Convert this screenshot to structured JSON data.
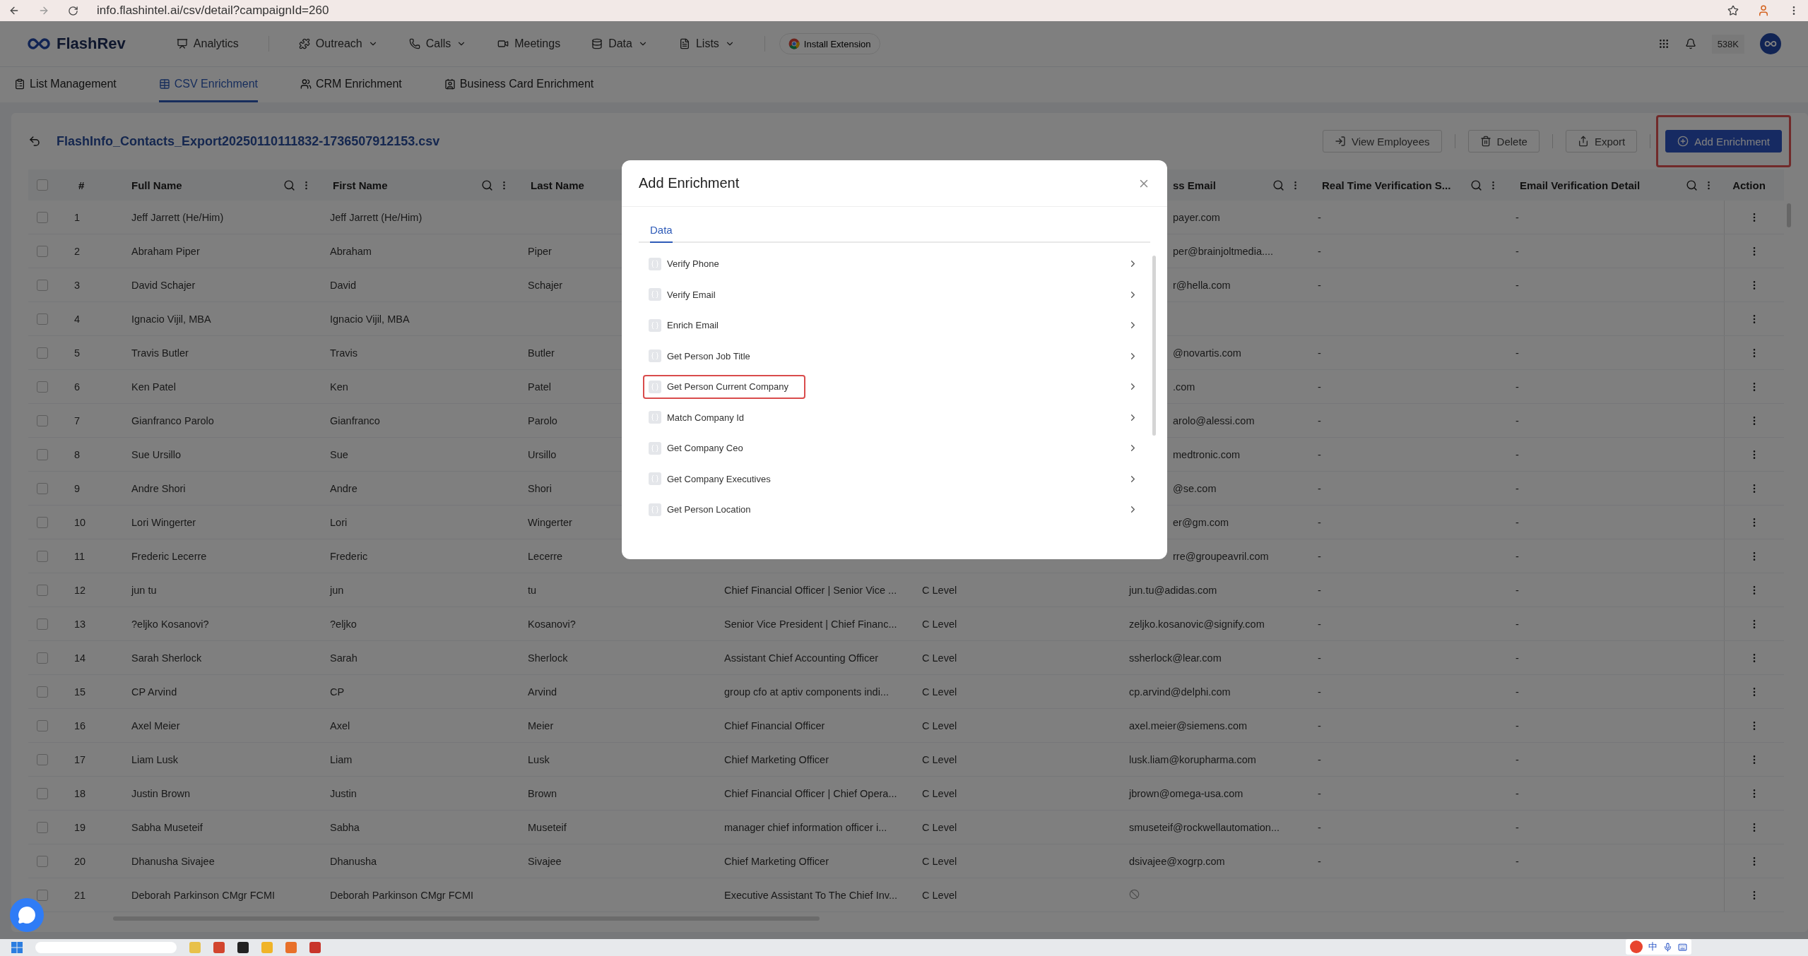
{
  "browser": {
    "url": "info.flashintel.ai/csv/detail?campaignId=260"
  },
  "header": {
    "logo": "FlashRev",
    "nav": [
      {
        "label": "Analytics",
        "kind": "chart",
        "dropdown": false
      },
      {
        "label": "Outreach",
        "kind": "puzzle",
        "dropdown": true
      },
      {
        "label": "Calls",
        "kind": "phone",
        "dropdown": true
      },
      {
        "label": "Meetings",
        "kind": "video",
        "dropdown": false
      },
      {
        "label": "Data",
        "kind": "database",
        "dropdown": true
      },
      {
        "label": "Lists",
        "kind": "list",
        "dropdown": true
      }
    ],
    "extension_button": "Install Extension",
    "credits": "538K"
  },
  "subtabs": [
    {
      "label": "List Management",
      "kind": "clipboard",
      "selected": false
    },
    {
      "label": "CSV Enrichment",
      "kind": "table",
      "selected": true
    },
    {
      "label": "CRM Enrichment",
      "kind": "users",
      "selected": false
    },
    {
      "label": "Business Card Enrichment",
      "kind": "card",
      "selected": false
    }
  ],
  "file_title": "FlashInfo_Contacts_Export20250110111832-1736507912153.csv",
  "actions": [
    {
      "label": "View Employees",
      "kind": "view",
      "primary": false,
      "highlighted": false
    },
    {
      "label": "Delete",
      "kind": "delete",
      "primary": false,
      "highlighted": false
    },
    {
      "label": "Export",
      "kind": "export",
      "primary": false,
      "highlighted": false
    },
    {
      "label": "Add Enrichment",
      "kind": "add",
      "primary": true,
      "highlighted": true
    }
  ],
  "table": {
    "header_checked": false,
    "columns": [
      {
        "label": "#",
        "tools": false,
        "kind": "text"
      },
      {
        "label": "Full Name",
        "tools": true,
        "kind": "text"
      },
      {
        "label": "First Name",
        "tools": true,
        "kind": "text"
      },
      {
        "label": "Last Name",
        "kind": "text"
      },
      {
        "kind": "covered"
      },
      {
        "kind": "covered"
      },
      {
        "label": "ss Email",
        "tools": true,
        "kind": "clipped"
      },
      {
        "label": "Real Time Verification S...",
        "tools": true,
        "kind": "text"
      },
      {
        "label": "Email Verification Detail",
        "tools": true,
        "kind": "text"
      },
      {
        "label": "Action",
        "tools": false,
        "kind": "center"
      }
    ],
    "rows": [
      {
        "checked": false,
        "clipped": true,
        "num": "1",
        "full_name": "Jeff Jarrett (He/Him)",
        "first_name": "Jeff Jarrett (He/Him)",
        "email": "payer.com",
        "rtv": "-",
        "evd": "-"
      },
      {
        "checked": false,
        "clipped": true,
        "num": "2",
        "full_name": "Abraham Piper",
        "first_name": "Abraham",
        "last_name": "Piper",
        "email": "per@brainjoltmedia....",
        "rtv": "-",
        "evd": "-"
      },
      {
        "checked": false,
        "clipped": true,
        "num": "3",
        "full_name": "David Schajer",
        "first_name": "David",
        "last_name": "Schajer",
        "email": "r@hella.com",
        "rtv": "-",
        "evd": "-"
      },
      {
        "checked": false,
        "num": "4",
        "full_name": "Ignacio Vijil, MBA",
        "first_name": "Ignacio Vijil, MBA"
      },
      {
        "checked": false,
        "clipped": true,
        "num": "5",
        "full_name": "Travis Butler",
        "first_name": "Travis",
        "last_name": "Butler",
        "email": "@novartis.com",
        "rtv": "-",
        "evd": "-"
      },
      {
        "checked": false,
        "clipped": true,
        "num": "6",
        "full_name": "Ken Patel",
        "first_name": "Ken",
        "last_name": "Patel",
        "email": ".com",
        "rtv": "-",
        "evd": "-"
      },
      {
        "checked": false,
        "clipped": true,
        "num": "7",
        "full_name": "Gianfranco Parolo",
        "first_name": "Gianfranco",
        "last_name": "Parolo",
        "email": "arolo@alessi.com",
        "rtv": "-",
        "evd": "-"
      },
      {
        "checked": false,
        "clipped": true,
        "num": "8",
        "full_name": "Sue Ursillo",
        "first_name": "Sue",
        "last_name": "Ursillo",
        "email": "medtronic.com",
        "rtv": "-",
        "evd": "-"
      },
      {
        "checked": false,
        "clipped": true,
        "num": "9",
        "full_name": "Andre Shori",
        "first_name": "Andre",
        "last_name": "Shori",
        "email": "@se.com",
        "rtv": "-",
        "evd": "-"
      },
      {
        "checked": false,
        "clipped": true,
        "num": "10",
        "full_name": "Lori Wingerter",
        "first_name": "Lori",
        "last_name": "Wingerter",
        "email": "er@gm.com",
        "rtv": "-",
        "evd": "-"
      },
      {
        "checked": false,
        "clipped": true,
        "num": "11",
        "full_name": "Frederic Lecerre",
        "first_name": "Frederic",
        "last_name": "Lecerre",
        "email": "rre@groupeavril.com",
        "rtv": "-",
        "evd": "-"
      },
      {
        "checked": false,
        "num": "12",
        "full_name": "jun tu",
        "first_name": "jun",
        "last_name": "tu",
        "title": "Chief Financial Officer | Senior Vice ...",
        "level": "C Level",
        "email": "jun.tu@adidas.com",
        "rtv": "-",
        "evd": "-"
      },
      {
        "checked": false,
        "num": "13",
        "full_name": "?eljko Kosanovi?",
        "first_name": "?eljko",
        "last_name": "Kosanovi?",
        "title": "Senior Vice President | Chief Financ...",
        "level": "C Level",
        "email": "zeljko.kosanovic@signify.com",
        "rtv": "-",
        "evd": "-"
      },
      {
        "checked": false,
        "num": "14",
        "full_name": "Sarah Sherlock",
        "first_name": "Sarah",
        "last_name": "Sherlock",
        "title": "Assistant Chief Accounting Officer",
        "level": "C Level",
        "email": "ssherlock@lear.com",
        "rtv": "-",
        "evd": "-"
      },
      {
        "checked": false,
        "num": "15",
        "full_name": "CP Arvind",
        "first_name": "CP",
        "last_name": "Arvind",
        "title": "group cfo at aptiv components indi...",
        "level": "C Level",
        "email": "cp.arvind@delphi.com",
        "rtv": "-",
        "evd": "-"
      },
      {
        "checked": false,
        "num": "16",
        "full_name": "Axel Meier",
        "first_name": "Axel",
        "last_name": "Meier",
        "title": "Chief Financial Officer",
        "level": "C Level",
        "email": "axel.meier@siemens.com",
        "rtv": "-",
        "evd": "-"
      },
      {
        "checked": false,
        "num": "17",
        "full_name": "Liam Lusk",
        "first_name": "Liam",
        "last_name": "Lusk",
        "title": "Chief Marketing Officer",
        "level": "C Level",
        "email": "lusk.liam@korupharma.com",
        "rtv": "-",
        "evd": "-"
      },
      {
        "checked": false,
        "num": "18",
        "full_name": "Justin Brown",
        "first_name": "Justin",
        "last_name": "Brown",
        "title": "Chief Financial Officer | Chief Opera...",
        "level": "C Level",
        "email": "jbrown@omega-usa.com",
        "rtv": "-",
        "evd": "-"
      },
      {
        "checked": false,
        "num": "19",
        "full_name": "Sabha Museteif",
        "first_name": "Sabha",
        "last_name": "Museteif",
        "title": "manager chief information officer i...",
        "level": "C Level",
        "email": "smuseteif@rockwellautomation...",
        "rtv": "-",
        "evd": "-"
      },
      {
        "checked": false,
        "num": "20",
        "full_name": "Dhanusha Sivajee",
        "first_name": "Dhanusha",
        "last_name": "Sivajee",
        "title": "Chief Marketing Officer",
        "level": "C Level",
        "email": "dsivajee@xogrp.com",
        "rtv": "-",
        "evd": "-"
      },
      {
        "checked": false,
        "num": "21",
        "full_name": "Deborah Parkinson CMgr FCMI",
        "first_name": "Deborah Parkinson CMgr FCMI",
        "title": "Executive Assistant To The Chief Inv...",
        "level": "C Level",
        "email_unavailable": true
      }
    ]
  },
  "dialog": {
    "title": "Add Enrichment",
    "tabs": [
      {
        "label": "Data",
        "selected": true
      }
    ],
    "items": [
      {
        "label": "Verify Phone",
        "highlighted": false
      },
      {
        "label": "Verify Email",
        "highlighted": false
      },
      {
        "label": "Enrich Email",
        "highlighted": false
      },
      {
        "label": "Get Person Job Title",
        "highlighted": false
      },
      {
        "label": "Get Person Current Company",
        "highlighted": true
      },
      {
        "label": "Match Company Id",
        "highlighted": false
      },
      {
        "label": "Get Company Ceo",
        "highlighted": false
      },
      {
        "label": "Get Company Executives",
        "highlighted": false
      },
      {
        "label": "Get Person Location",
        "highlighted": false
      }
    ]
  },
  "ime": {
    "label": "中"
  }
}
